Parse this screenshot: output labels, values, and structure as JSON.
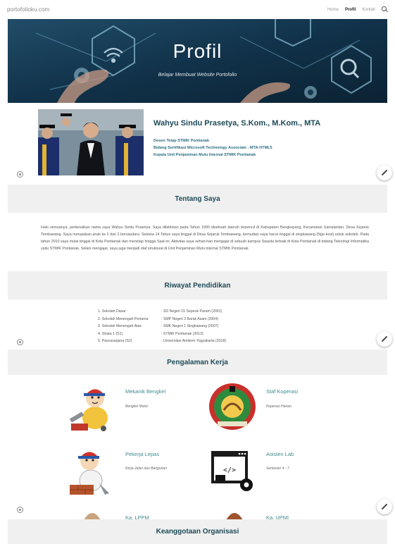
{
  "nav": {
    "brand": "portofolioku.com",
    "links": [
      "Home",
      "Profil",
      "Kontak"
    ]
  },
  "hero": {
    "title": "Profil",
    "subtitle": "Belajar Membuat Website Portofolio"
  },
  "profile": {
    "name": "Wahyu Sindu Prasetya, S.Kom., M.Kom., MTA",
    "roles": [
      "Dosen Tetap STMIK Pontianak",
      "Bidang Sertifikasi Microsoft Technology Associate - MTA-HTML5",
      "Kepala Unit Penjaminan Mutu Internal STMIK Pontianak"
    ]
  },
  "about": {
    "heading": "Tentang Saya",
    "text": "Halo semuanya, perkenalkan nama saya Wahyu Sindu Prasetya. Saya dilahirkan pada Tahun 1990 disebuah daerah terpencil di Kabupaten Bengkayang, Kecamatan Samalantan, Desa Sejaruk Tembawang. Saya merupakan anak ke 2 dari 2 bersaudara. Selama 14 Tahun saya tinggal di Desa Sejaruk Tembawang, kemudian saya harus tinggal di singkawang (Nge-kost) untuk sekolah. Pada tahun 2010 saya mulai tinggal di Kota Pontianak dan menetap hingga Saat ini. Aktivitas saya sehari-hari mengajar di sebuah kampus Swasta terbaik di Kota Pontianak di bidang Teknologi Informatika yaitu STMIK Pontianak. Selain mengajar, saya juga menjadi staf struktural di Unit Penjaminan Mutu internal STMIK Pontianak."
  },
  "education": {
    "heading": "Riwayat Pendidikan",
    "rows": [
      {
        "level": "1. Sekolah Dasar",
        "school": ": SD Negeri 15 Sejaruk Param (2001)"
      },
      {
        "level": "2. Sekolah Menengah Pertama",
        "school": ": SMP Negeri 3 Barak Asam (2004)"
      },
      {
        "level": "3. Sekolah Menengah Atas",
        "school": ": SMK Negeri 1 Singkawang (2007)"
      },
      {
        "level": "4. Strata 1 (S1)",
        "school": ": STMIK Pontianak (2013)"
      },
      {
        "level": "5. Pascasarjana (S2)",
        "school": ": Universitas Amikom Yogyakarta (2018)"
      }
    ]
  },
  "experience": {
    "heading": "Pengalaman Kerja",
    "jobs": [
      {
        "title": "Mekanik Bengkel",
        "desc": "Bengkel Motor",
        "icon": "mechanic-icon"
      },
      {
        "title": "Staf Koperasi",
        "desc": "Koperasi Harian",
        "icon": "cooperative-logo-icon"
      },
      {
        "title": "Pekerja Lepas",
        "desc": "Kerja Jalan dan Bangunan",
        "icon": "builder-icon"
      },
      {
        "title": "Asisten Lab",
        "desc": "Semester 4 - 7",
        "icon": "lab-computer-icon"
      },
      {
        "title": "Ka. LPPM",
        "desc": "",
        "icon": "person-icon"
      },
      {
        "title": "Ka. UPMI",
        "desc": "",
        "icon": "person-icon"
      }
    ]
  },
  "organization": {
    "heading": "Keanggotaan Organisasi"
  },
  "colors": {
    "accent": "#1d4a57",
    "job_title": "#3f8a8e",
    "section_bg": "#f0f0f0",
    "hero_bg": "#0f2c40"
  }
}
